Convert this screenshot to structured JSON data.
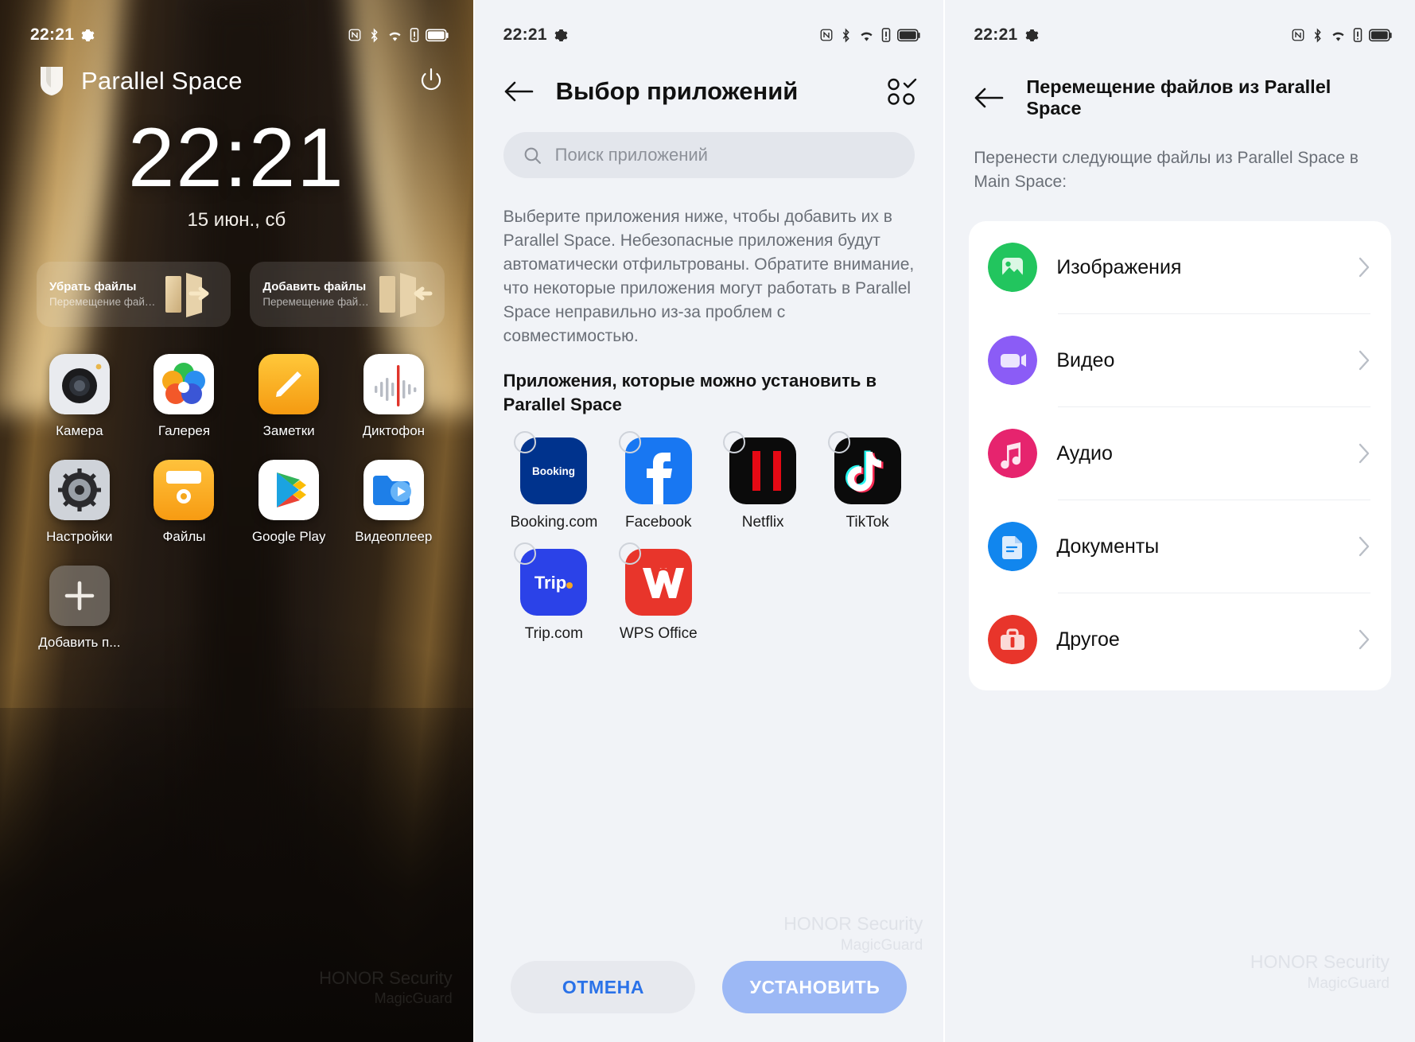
{
  "status_bar": {
    "time": "22:21",
    "icons": [
      "gear-icon",
      "nfc-icon",
      "bluetooth-icon",
      "wifi-icon",
      "alert-icon",
      "battery-icon"
    ]
  },
  "panel1": {
    "app_title": "Parallel Space",
    "shield_icon": "shield-icon",
    "power_icon": "power-icon",
    "clock": "22:21",
    "date": "15 июн., сб",
    "widgets": [
      {
        "title": "Убрать файлы",
        "subtitle": "Перемещение файлов из Pa...",
        "icon": "move-out-icon"
      },
      {
        "title": "Добавить файлы",
        "subtitle": "Перемещение файлов из M...",
        "icon": "move-in-icon"
      }
    ],
    "apps": [
      {
        "label": "Камера",
        "icon": "camera-icon"
      },
      {
        "label": "Галерея",
        "icon": "gallery-icon"
      },
      {
        "label": "Заметки",
        "icon": "notes-icon"
      },
      {
        "label": "Диктофон",
        "icon": "recorder-icon"
      },
      {
        "label": "Настройки",
        "icon": "settings-icon"
      },
      {
        "label": "Файлы",
        "icon": "files-icon"
      },
      {
        "label": "Google Play",
        "icon": "google-play-icon"
      },
      {
        "label": "Видеоплеер",
        "icon": "video-player-icon"
      },
      {
        "label": "Добавить п...",
        "icon": "plus-icon"
      }
    ],
    "watermark": {
      "line1": "HONOR Security",
      "line2": "MagicGuard"
    }
  },
  "panel2": {
    "title": "Выбор приложений",
    "back_icon": "back-arrow-icon",
    "multiselect_icon": "multi-select-icon",
    "search": {
      "placeholder": "Поиск приложений",
      "icon": "search-icon"
    },
    "description": "Выберите приложения ниже, чтобы добавить их в Parallel Space. Небезопасные приложения будут автоматически отфильтрованы. Обратите внимание, что некоторые приложения могут работать в Parallel Space неправильно из-за проблем с совместимостью.",
    "section_heading": "Приложения, которые можно установить в Parallel Space",
    "apps": [
      {
        "label": "Booking.com",
        "icon": "booking-icon",
        "checked": false
      },
      {
        "label": "Facebook",
        "icon": "facebook-icon",
        "checked": false
      },
      {
        "label": "Netflix",
        "icon": "netflix-icon",
        "checked": false
      },
      {
        "label": "TikTok",
        "icon": "tiktok-icon",
        "checked": false
      },
      {
        "label": "Trip.com",
        "icon": "tripcom-icon",
        "checked": false
      },
      {
        "label": "WPS Office",
        "icon": "wps-office-icon",
        "checked": false
      }
    ],
    "buttons": {
      "cancel": "ОТМЕНА",
      "install": "УСТАНОВИТЬ"
    },
    "watermark": {
      "line1": "HONOR Security",
      "line2": "MagicGuard"
    },
    "colors": {
      "cancel_text": "#2a72e8",
      "install_bg": "#9cb8f5",
      "background": "#f1f3f7"
    }
  },
  "panel3": {
    "title": "Перемещение файлов из Parallel Space",
    "back_icon": "back-arrow-icon",
    "description": "Перенести следующие файлы из Parallel Space в Main Space:",
    "items": [
      {
        "label": "Изображения",
        "icon": "image-icon",
        "color": "#22c55e",
        "chevron": "chevron-right-icon"
      },
      {
        "label": "Видео",
        "icon": "video-icon",
        "color": "#8b5cf6",
        "chevron": "chevron-right-icon"
      },
      {
        "label": "Аудио",
        "icon": "audio-icon",
        "color": "#e6246e",
        "chevron": "chevron-right-icon"
      },
      {
        "label": "Документы",
        "icon": "document-icon",
        "color": "#1186ee",
        "chevron": "chevron-right-icon"
      },
      {
        "label": "Другое",
        "icon": "other-icon",
        "color": "#e8352b",
        "chevron": "chevron-right-icon"
      }
    ],
    "watermark": {
      "line1": "HONOR Security",
      "line2": "MagicGuard"
    }
  }
}
